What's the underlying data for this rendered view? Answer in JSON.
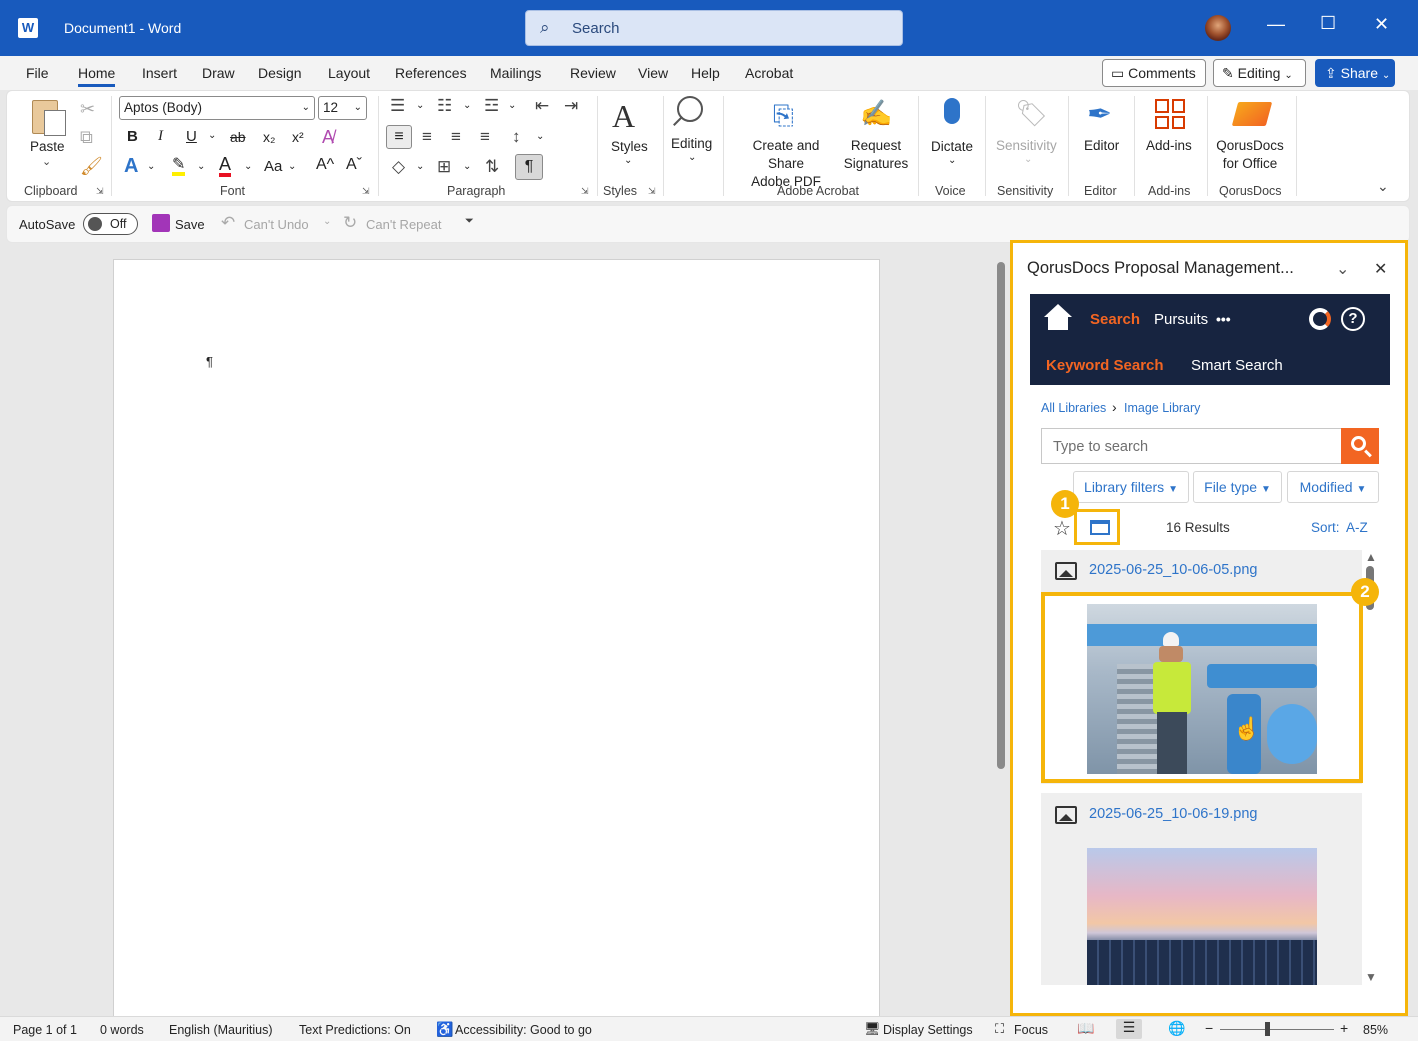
{
  "titlebar": {
    "app_icon": "W",
    "title": "Document1  -  Word",
    "search_placeholder": "Search",
    "minimize": "—",
    "maximize": "☐",
    "close": "✕"
  },
  "tabs": [
    "File",
    "Home",
    "Insert",
    "Draw",
    "Design",
    "Layout",
    "References",
    "Mailings",
    "Review",
    "View",
    "Help",
    "Acrobat"
  ],
  "active_tab": "Home",
  "top_right": {
    "comments": "Comments",
    "editing": "Editing",
    "share": "Share"
  },
  "ribbon": {
    "clipboard": {
      "paste": "Paste",
      "label": "Clipboard"
    },
    "font": {
      "name": "Aptos (Body)",
      "size": "12",
      "label": "Font",
      "bold": "B",
      "italic": "I",
      "underline": "U",
      "strike": "ab",
      "sub": "x₂",
      "sup": "x²",
      "case": "Aa",
      "grow": "A^",
      "shrink": "Aˇ"
    },
    "paragraph": {
      "label": "Paragraph",
      "pilcrow": "¶"
    },
    "styles": {
      "button": "Styles",
      "label": "Styles"
    },
    "editing": {
      "button": "Editing"
    },
    "acrobat": {
      "create": "Create and Share",
      "create2": "Adobe PDF",
      "request": "Request",
      "request2": "Signatures",
      "label": "Adobe Acrobat"
    },
    "voice": {
      "button": "Dictate",
      "label": "Voice"
    },
    "sensitivity": {
      "button": "Sensitivity",
      "label": "Sensitivity"
    },
    "editor": {
      "button": "Editor",
      "label": "Editor"
    },
    "addins": {
      "button": "Add-ins",
      "label": "Add-ins"
    },
    "qorus": {
      "button": "QorusDocs",
      "button2": "for Office",
      "label": "QorusDocs"
    }
  },
  "qat": {
    "autosave": "AutoSave",
    "toggle": "Off",
    "save": "Save",
    "undo": "Can't Undo",
    "repeat": "Can't Repeat"
  },
  "document": {
    "pilcrow": "¶"
  },
  "pane": {
    "title": "QorusDocs Proposal Management...",
    "nav": {
      "search": "Search",
      "pursuits": "Pursuits",
      "more": "•••",
      "keyword": "Keyword Search",
      "smart": "Smart Search"
    },
    "breadcrumb": {
      "root": "All Libraries",
      "sep": "›",
      "current": "Image Library"
    },
    "search_placeholder": "Type to search",
    "filters": {
      "library": "Library filters",
      "filetype": "File type",
      "modified": "Modified"
    },
    "results_count": "16 Results",
    "sort_label": "Sort:",
    "sort_value": "A-Z",
    "results": [
      {
        "name": "2025-06-25_10-06-05.png"
      },
      {
        "name": "2025-06-25_10-06-19.png"
      }
    ],
    "callouts": [
      "1",
      "2"
    ]
  },
  "statusbar": {
    "page": "Page 1 of 1",
    "words": "0 words",
    "language": "English (Mauritius)",
    "predictions": "Text Predictions: On",
    "accessibility": "Accessibility: Good to go",
    "display": "Display Settings",
    "focus": "Focus",
    "zoom": "85%",
    "minus": "−",
    "plus": "+"
  },
  "colors": {
    "word_blue": "#185abd",
    "qorus_navy": "#172440",
    "qorus_orange": "#f26522",
    "callout_yellow": "#f5b50a"
  }
}
